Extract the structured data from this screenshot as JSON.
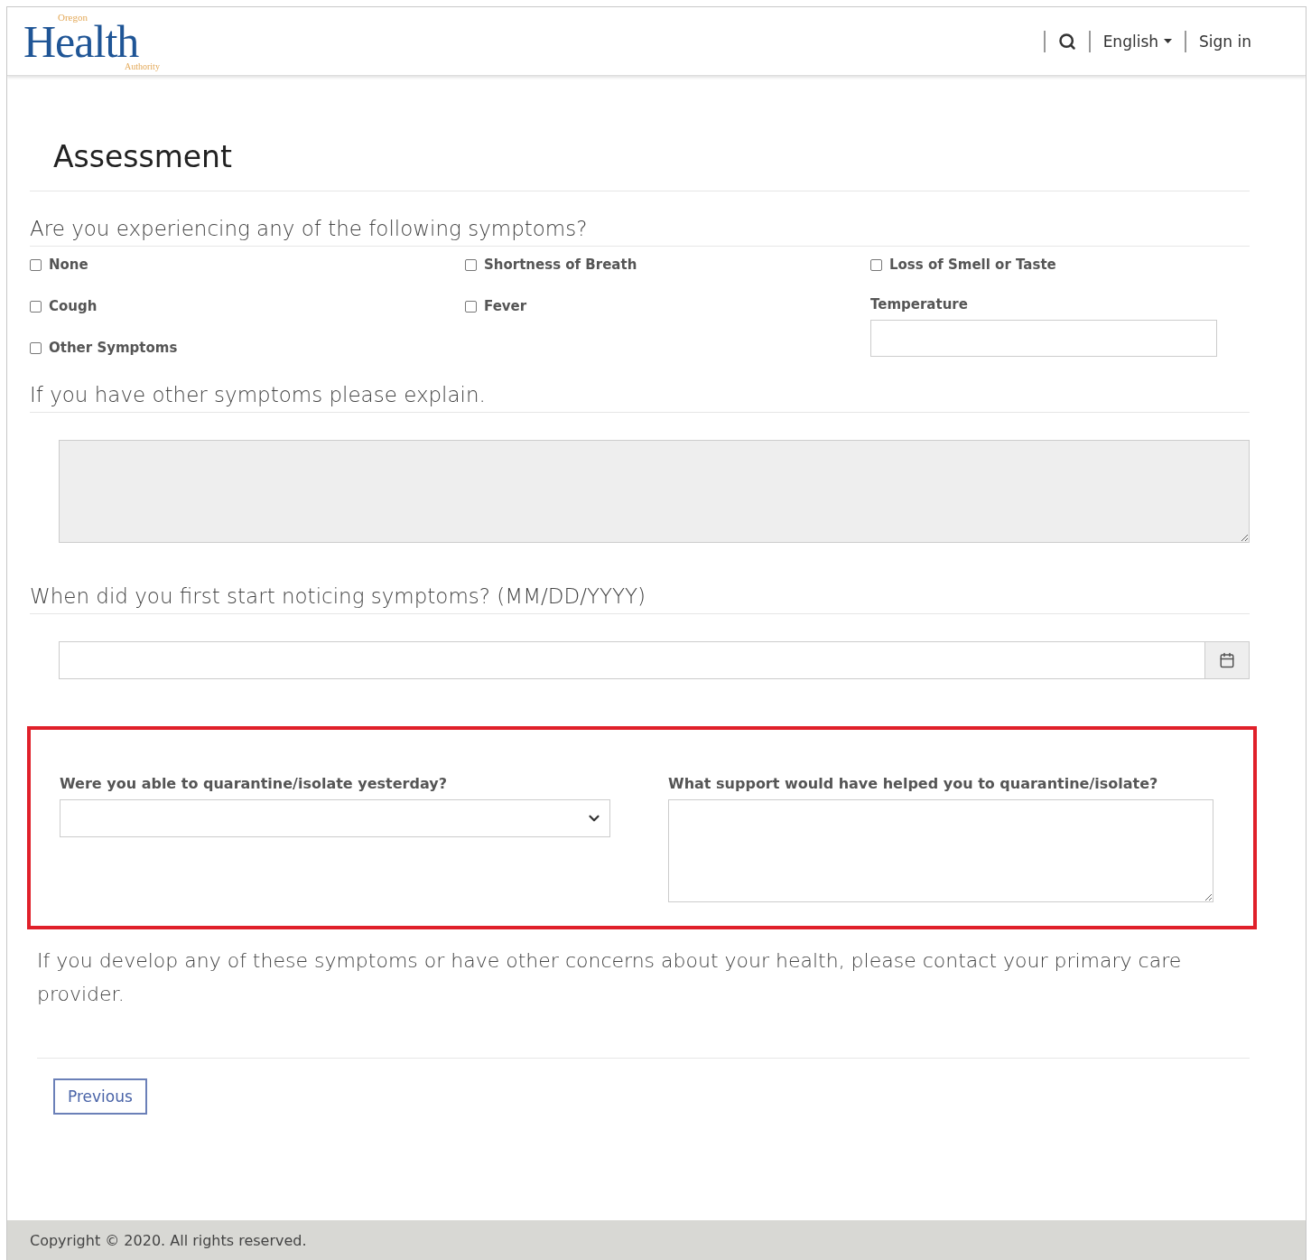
{
  "header": {
    "logo": {
      "top": "Oregon",
      "main": "Health",
      "bottom": "Authority"
    },
    "language": "English",
    "sign_in": "Sign in"
  },
  "title": "Assessment",
  "symptoms": {
    "question": "Are you experiencing any of the following symptoms?",
    "fields": [
      {
        "kind": "checkbox",
        "label": "None",
        "checked": false
      },
      {
        "kind": "checkbox",
        "label": "Shortness of Breath",
        "checked": false
      },
      {
        "kind": "checkbox",
        "label": "Loss of Smell or Taste",
        "checked": false
      },
      {
        "kind": "checkbox",
        "label": "Cough",
        "checked": false
      },
      {
        "kind": "checkbox",
        "label": "Fever",
        "checked": false
      },
      {
        "kind": "text-input",
        "label": "Temperature"
      },
      {
        "kind": "checkbox",
        "label": "Other Symptoms",
        "checked": false
      }
    ]
  },
  "other_explain": {
    "question": "If you have other symptoms please explain.",
    "disabled": true
  },
  "start_date": {
    "question": "When did you first start noticing symptoms? (MM/DD/YYYY)"
  },
  "quarantine": {
    "highlighted": true,
    "select_label": "Were you able to quarantine/isolate yesterday?",
    "support_label": "What support would have helped you to quarantine/isolate?"
  },
  "notice": "If you develop any of these symptoms or have other concerns about your health, please contact your primary care provider.",
  "buttons": [
    "Previous"
  ],
  "footer": "Copyright © 2020. All rights reserved."
}
